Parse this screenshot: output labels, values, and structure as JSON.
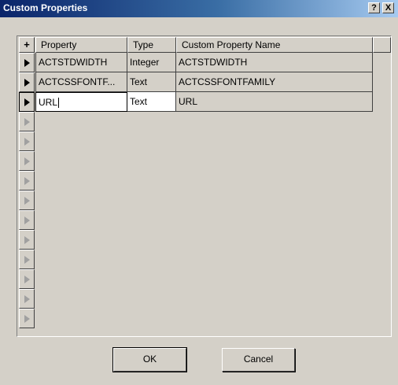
{
  "window": {
    "title": "Custom Properties",
    "help_label": "?",
    "close_label": "X"
  },
  "grid": {
    "corner_label": "+",
    "columns": [
      "Property",
      "Type",
      "Custom Property Name"
    ],
    "rows": [
      {
        "property": "ACTSTDWIDTH",
        "type": "Integer",
        "custom_name": "ACTSTDWIDTH"
      },
      {
        "property": "ACTCSSFONTF...",
        "type": "Text",
        "custom_name": "ACTCSSFONTFAMILY"
      },
      {
        "property": "URL",
        "type": "Text",
        "custom_name": "URL"
      }
    ],
    "current_row_index": 2
  },
  "buttons": {
    "ok_label": "OK",
    "cancel_label": "Cancel"
  }
}
